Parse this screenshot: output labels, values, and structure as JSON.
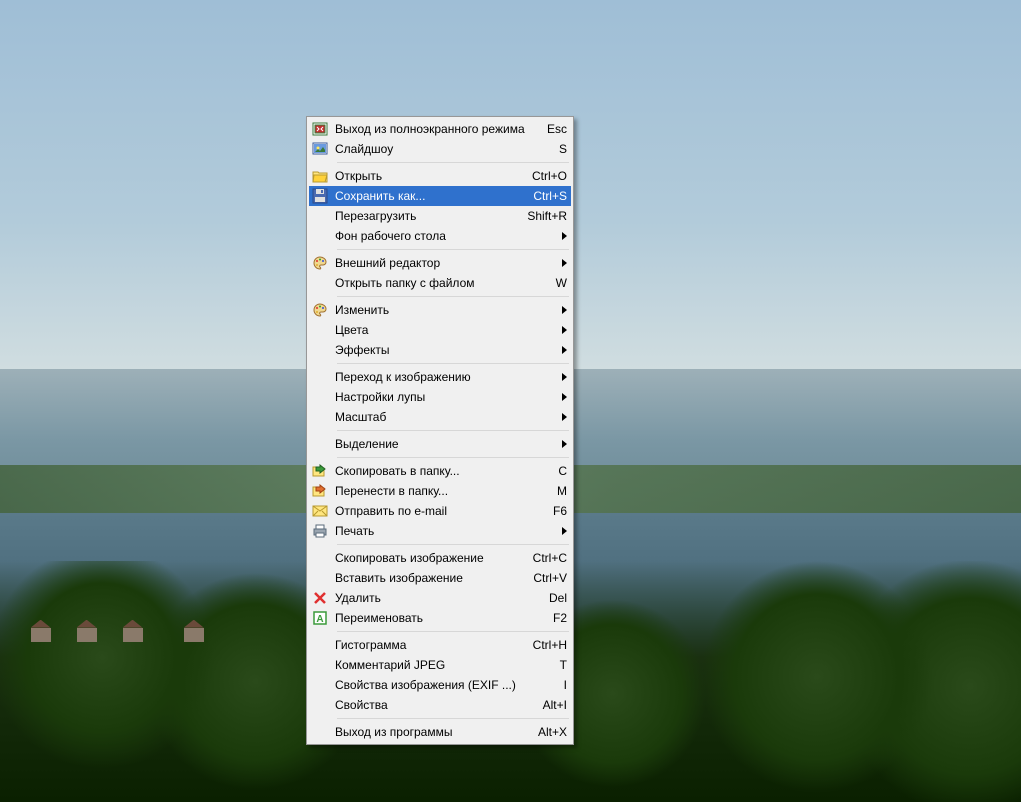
{
  "menu": {
    "groups": [
      [
        {
          "icon": "fullscreen-exit",
          "label": "Выход из полноэкранного режима",
          "shortcut": "Esc"
        },
        {
          "icon": "slideshow",
          "label": "Слайдшоу",
          "shortcut": "S"
        }
      ],
      [
        {
          "icon": "open",
          "label": "Открыть",
          "shortcut": "Ctrl+O"
        },
        {
          "icon": "save",
          "label": "Сохранить как...",
          "shortcut": "Ctrl+S",
          "highlight": true
        },
        {
          "label": "Перезагрузить",
          "shortcut": "Shift+R"
        },
        {
          "label": "Фон рабочего стола",
          "submenu": true
        }
      ],
      [
        {
          "icon": "palette",
          "label": "Внешний редактор",
          "submenu": true
        },
        {
          "label": "Открыть папку с файлом",
          "shortcut": "W"
        }
      ],
      [
        {
          "icon": "palette",
          "label": "Изменить",
          "submenu": true
        },
        {
          "label": "Цвета",
          "submenu": true
        },
        {
          "label": "Эффекты",
          "submenu": true
        }
      ],
      [
        {
          "label": "Переход к изображению",
          "submenu": true
        },
        {
          "label": "Настройки лупы",
          "submenu": true
        },
        {
          "label": "Масштаб",
          "submenu": true
        }
      ],
      [
        {
          "label": "Выделение",
          "submenu": true
        }
      ],
      [
        {
          "icon": "copyto",
          "label": "Скопировать в папку...",
          "shortcut": "C"
        },
        {
          "icon": "moveto",
          "label": "Перенести в папку...",
          "shortcut": "M"
        },
        {
          "icon": "email",
          "label": "Отправить по e-mail",
          "shortcut": "F6"
        },
        {
          "icon": "print",
          "label": "Печать",
          "submenu": true
        }
      ],
      [
        {
          "label": "Скопировать изображение",
          "shortcut": "Ctrl+C"
        },
        {
          "label": "Вставить изображение",
          "shortcut": "Ctrl+V"
        },
        {
          "icon": "delete",
          "label": "Удалить",
          "shortcut": "Del"
        },
        {
          "icon": "rename",
          "label": "Переименовать",
          "shortcut": "F2"
        }
      ],
      [
        {
          "label": "Гистограмма",
          "shortcut": "Ctrl+H"
        },
        {
          "label": "Комментарий JPEG",
          "shortcut": "T"
        },
        {
          "label": "Свойства изображения (EXIF ...)",
          "shortcut": "I"
        },
        {
          "label": "Свойства",
          "shortcut": "Alt+I"
        }
      ],
      [
        {
          "label": "Выход из программы",
          "shortcut": "Alt+X"
        }
      ]
    ]
  }
}
